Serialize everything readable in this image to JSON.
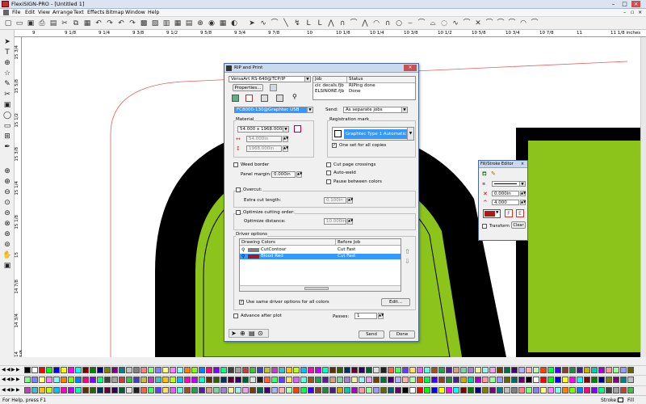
{
  "app": {
    "title": "FlexiSIGN-PRO - [Untitled 1]",
    "menu": [
      "File",
      "Edit",
      "View",
      "Arrange",
      "Text",
      "Effects",
      "Bitmap",
      "Window",
      "Help"
    ]
  },
  "ruler": {
    "h_ticks": [
      "9",
      "9 1/8",
      "9 1/4",
      "9 3/8",
      "9 1/2",
      "9 5/8",
      "9 3/4",
      "9 7/8",
      "10",
      "10 1/8",
      "10 1/4",
      "10 3/8",
      "10 1/2",
      "10 5/8",
      "10 3/4",
      "10 7/8",
      "11",
      "11 1/8 inches"
    ],
    "v_ticks": [
      "15 3/4",
      "15 5/8",
      "15 1/2",
      "15 3/8",
      "15 1/4",
      "15 1/8",
      "15",
      "14 7/8",
      "14 3/4",
      "14 5/8"
    ]
  },
  "rip": {
    "title": "RIP and Print",
    "device": "VersaArt RS-640@TCP/IP",
    "properties_label": "Properties...",
    "job_header": "Job",
    "status_header": "Status",
    "jobs": [
      {
        "job": "cic decals.fjb",
        "status": "RIPing done"
      },
      {
        "job": "ELSINORE.fjb",
        "status": "Done"
      }
    ],
    "cutter": "FC8000-130@Graphtec USB",
    "send_label": "Send:",
    "send_value": "As separate jobs",
    "material_label": "Material",
    "material_value": "54.000 x 1968.000in",
    "width_value": "54.000in",
    "length_value": "1968.000in",
    "reg_label": "Registration mark",
    "reg_value": "Graphtec Type 1 Automatic",
    "one_set_label": "One set for all copies",
    "weed_border_label": "Weed border",
    "panel_margin_label": "Panel margin:",
    "panel_margin_value": "0.000in",
    "cut_page_label": "Cut page crossings",
    "auto_weld_label": "Auto-weld",
    "pause_label": "Pause between colors",
    "overcut_label": "Overcut:",
    "extra_cut_label": "Extra cut length:",
    "extra_cut_value": "0.100in",
    "optimize_label": "Optimize cutting order:",
    "optimize_dist_label": "Optimize distance:",
    "optimize_dist_value": "10.000in",
    "driver_label": "Driver options",
    "col_drawing": "Drawing Colors",
    "col_before": "Before Job",
    "drivers": [
      {
        "name": "CutContour",
        "action": "Cut Fast",
        "color": "#808080"
      },
      {
        "name": "Blood Red",
        "action": "Cut Fast",
        "color": "#b01818"
      }
    ],
    "same_driver_label": "Use same driver options for all colors",
    "edit_label": "Edit...",
    "advance_label": "Advance after plot",
    "passes_label": "Passes:",
    "passes_value": "1",
    "send_btn": "Send",
    "done_btn": "Done"
  },
  "fse": {
    "title": "Fill/Stroke Editor",
    "width_value": "0.000in",
    "miter_value": "4.000",
    "transform_label": "Transform",
    "clear_label": "Clear"
  },
  "status": {
    "help": "For Help, press F1",
    "stroke_label": "Stroke:",
    "fill_label": "Fill"
  },
  "colors": {
    "green": "#8cc41c",
    "black": "#000000",
    "red_outline": "#e06060",
    "accent": "#3399ff"
  },
  "palette": [
    "#000000",
    "#ffffff",
    "#ff0000",
    "#00ff00",
    "#0000ff",
    "#ffff00",
    "#ff00ff",
    "#00ffff",
    "#800000",
    "#008000",
    "#000080",
    "#808000",
    "#800080",
    "#008080",
    "#c0c0c0",
    "#808080",
    "#ff8080",
    "#80ff80",
    "#8080ff",
    "#ffff80",
    "#ff80ff",
    "#80ffff",
    "#ff8000",
    "#80ff00",
    "#0080ff",
    "#ff0080",
    "#8000ff",
    "#00ff80",
    "#404040",
    "#a0a0a0",
    "#c04040",
    "#40c040",
    "#4040c0",
    "#c0c040",
    "#c040c0",
    "#40c0c0",
    "#ffc000",
    "#c0ff00",
    "#00c0ff",
    "#ff00c0",
    "#c000ff",
    "#00ffc0",
    "#603000",
    "#306000",
    "#003060",
    "#600030",
    "#300060",
    "#006030",
    "#e0e0e0",
    "#202020",
    "#ff6040",
    "#40ff60",
    "#6040ff",
    "#ffe060",
    "#e060ff",
    "#60ffe0",
    "#a05020",
    "#20a050",
    "#5020a0",
    "#d0a080",
    "#80d0a0",
    "#a080d0",
    "#f0f0a0",
    "#a0f0f0",
    "#f0a0f0",
    "#704000",
    "#007040",
    "#400070",
    "#b0b0ff",
    "#ffb0b0",
    "#b0ffb0",
    "#ff4000",
    "#00ff40",
    "#4000ff",
    "#884422",
    "#228844",
    "#442288",
    "#ccaa00",
    "#00ccaa",
    "#aa00cc",
    "#ff9999",
    "#99ff99",
    "#9999ff",
    "#666600",
    "#006666",
    "#660066"
  ]
}
